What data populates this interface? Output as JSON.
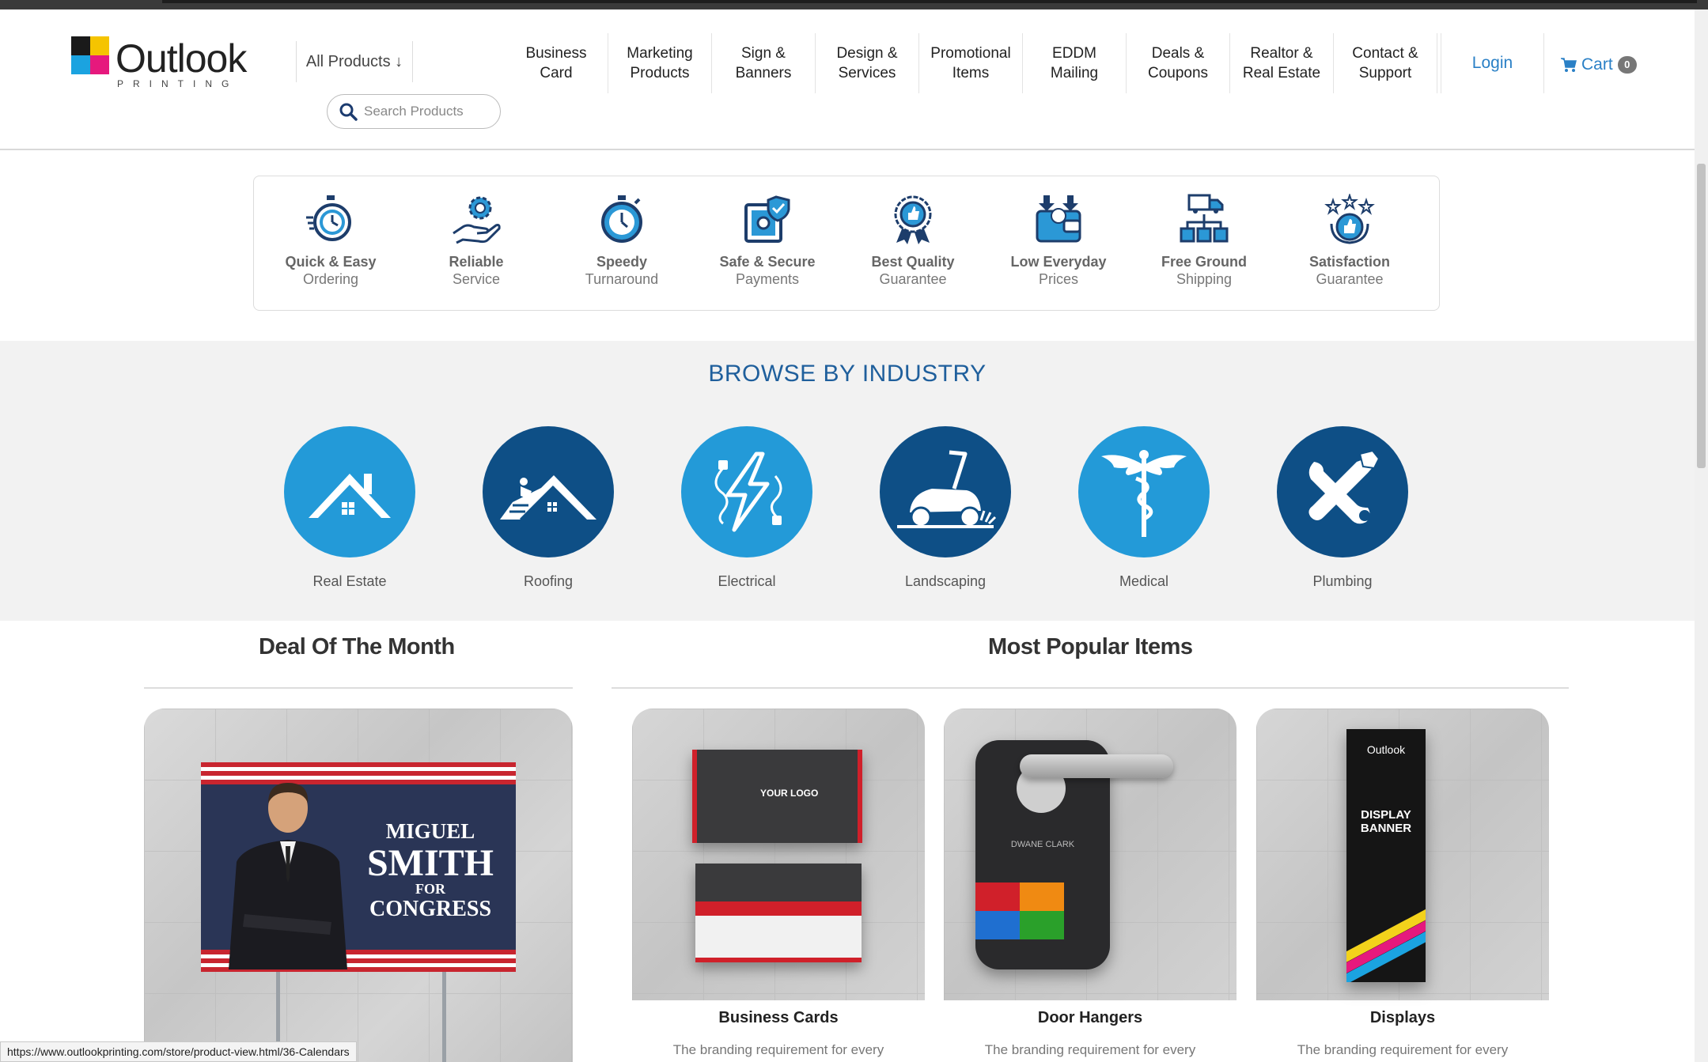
{
  "brand": {
    "name": "Outlook",
    "tagline": "PRINTING",
    "colors": {
      "accent_blue": "#2a80c6",
      "dark_blue": "#1f5f9c",
      "circle_light": "#239ad8",
      "circle_dark": "#0e4f86"
    }
  },
  "header": {
    "all_products": "All Products ↓",
    "search_placeholder": "Search Products",
    "nav": [
      {
        "label": "Business\nCard"
      },
      {
        "label": "Marketing\nProducts"
      },
      {
        "label": "Sign &\nBanners"
      },
      {
        "label": "Design &\nServices"
      },
      {
        "label": "Promotional\nItems"
      },
      {
        "label": "EDDM\nMailing"
      },
      {
        "label": "Deals &\nCoupons"
      },
      {
        "label": "Realtor &\nReal Estate"
      },
      {
        "label": "Contact &\nSupport"
      }
    ],
    "login": "Login",
    "cart_label": "Cart",
    "cart_count": "0"
  },
  "features": [
    {
      "line1": "Quick & Easy",
      "line2": "Ordering",
      "icon": "stopwatch-icon"
    },
    {
      "line1": "Reliable",
      "line2": "Service",
      "icon": "gear-hand-icon"
    },
    {
      "line1": "Speedy",
      "line2": "Turnaround",
      "icon": "timer-icon"
    },
    {
      "line1": "Safe & Secure",
      "line2": "Payments",
      "icon": "safe-icon"
    },
    {
      "line1": "Best Quality",
      "line2": "Guarantee",
      "icon": "badge-icon"
    },
    {
      "line1": "Low Everyday",
      "line2": "Prices",
      "icon": "wallet-icon"
    },
    {
      "line1": "Free Ground",
      "line2": "Shipping",
      "icon": "truck-icon"
    },
    {
      "line1": "Satisfaction",
      "line2": "Guarantee",
      "icon": "thumbs-up-icon"
    }
  ],
  "industry": {
    "title": "BROWSE BY INDUSTRY",
    "items": [
      {
        "label": "Real Estate",
        "icon": "house-icon"
      },
      {
        "label": "Roofing",
        "icon": "roof-icon"
      },
      {
        "label": "Electrical",
        "icon": "lightning-icon"
      },
      {
        "label": "Landscaping",
        "icon": "lawnmower-icon"
      },
      {
        "label": "Medical",
        "icon": "caduceus-icon"
      },
      {
        "label": "Plumbing",
        "icon": "wrench-icon"
      }
    ]
  },
  "deal": {
    "title": "Deal Of The Month",
    "sign": {
      "first": "MIGUEL",
      "last": "SMITH",
      "for": "FOR",
      "office": "CONGRESS"
    }
  },
  "popular": {
    "title": "Most Popular Items",
    "items": [
      {
        "title": "Business Cards",
        "desc": "The branding requirement for every",
        "logo_text": "YOUR LOGO"
      },
      {
        "title": "Door Hangers",
        "desc": "The branding requirement for every",
        "hanger_name": "DWANE CLARK"
      },
      {
        "title": "Displays",
        "desc": "The branding requirement for every",
        "banner_brand": "Outlook",
        "banner_text": "DISPLAY BANNER"
      }
    ]
  },
  "status_url": "https://www.outlookprinting.com/store/product-view.html/36-Calendars"
}
